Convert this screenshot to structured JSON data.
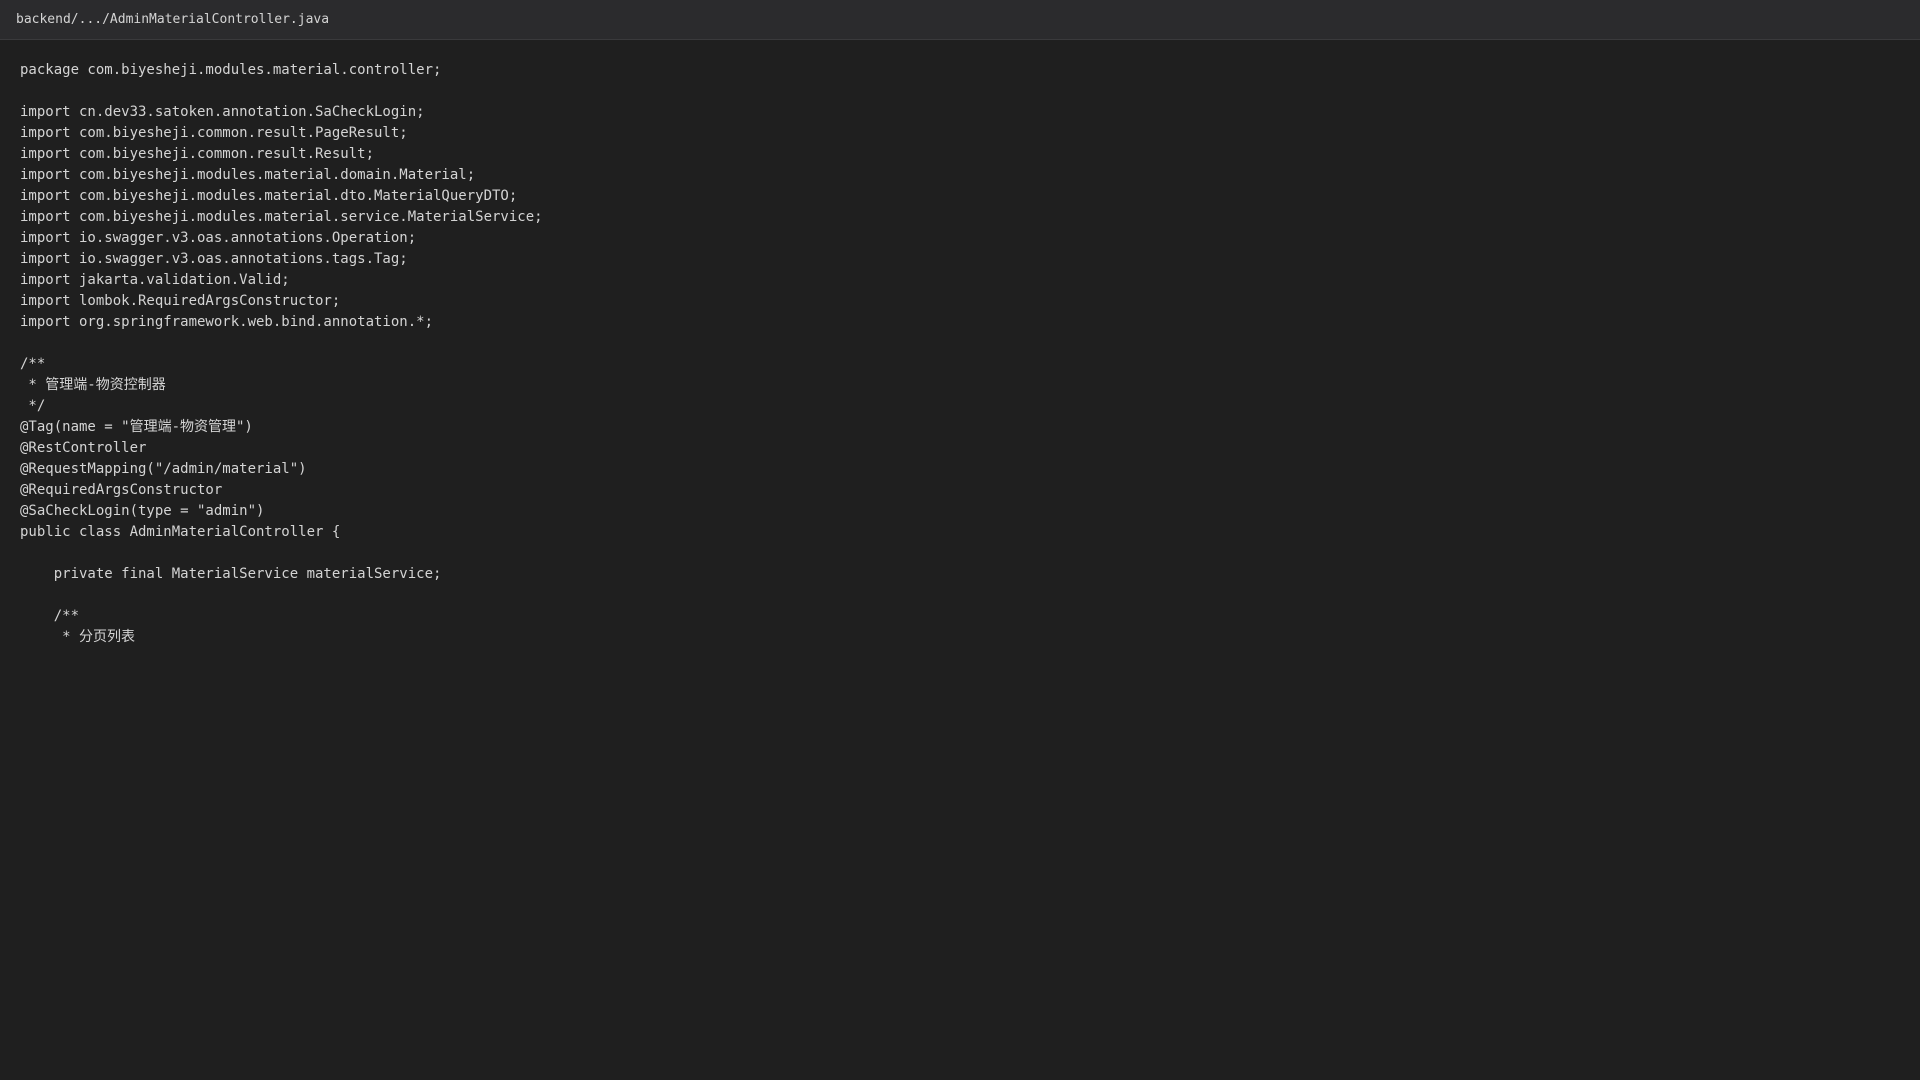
{
  "header": {
    "file_path": "backend/.../AdminMaterialController.java"
  },
  "code": {
    "lines": [
      "package com.biyesheji.modules.material.controller;",
      "",
      "import cn.dev33.satoken.annotation.SaCheckLogin;",
      "import com.biyesheji.common.result.PageResult;",
      "import com.biyesheji.common.result.Result;",
      "import com.biyesheji.modules.material.domain.Material;",
      "import com.biyesheji.modules.material.dto.MaterialQueryDTO;",
      "import com.biyesheji.modules.material.service.MaterialService;",
      "import io.swagger.v3.oas.annotations.Operation;",
      "import io.swagger.v3.oas.annotations.tags.Tag;",
      "import jakarta.validation.Valid;",
      "import lombok.RequiredArgsConstructor;",
      "import org.springframework.web.bind.annotation.*;",
      "",
      "/**",
      " * 管理端-物资控制器",
      " */",
      "@Tag(name = \"管理端-物资管理\")",
      "@RestController",
      "@RequestMapping(\"/admin/material\")",
      "@RequiredArgsConstructor",
      "@SaCheckLogin(type = \"admin\")",
      "public class AdminMaterialController {",
      "",
      "    private final MaterialService materialService;",
      "",
      "    /**",
      "     * 分页列表"
    ]
  }
}
